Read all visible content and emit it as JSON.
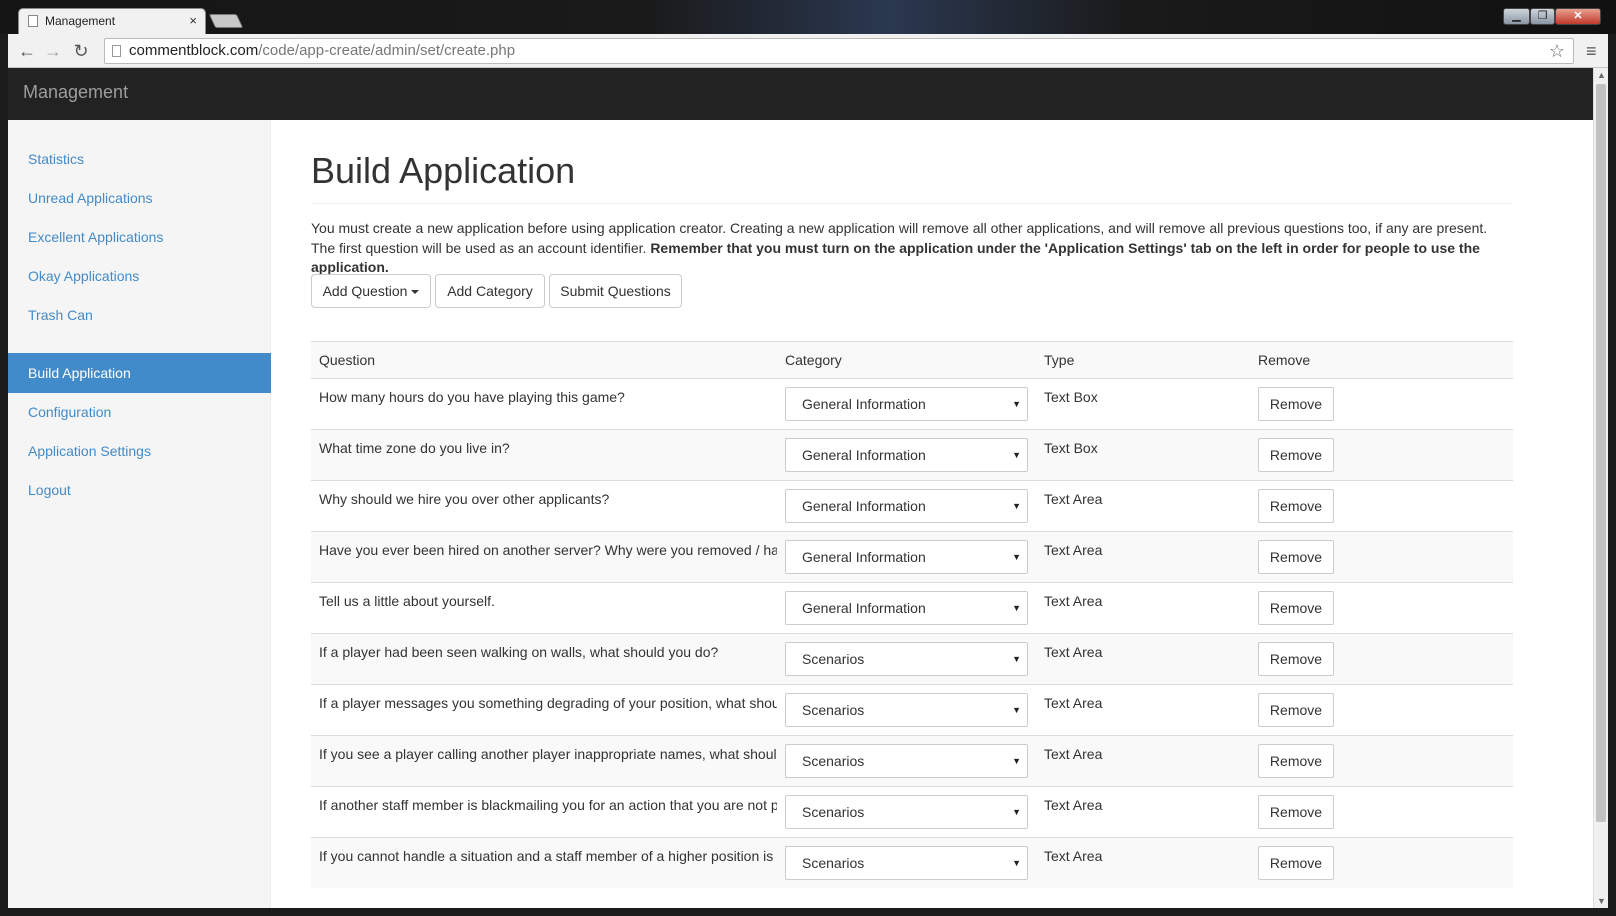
{
  "browser": {
    "tab_title": "Management",
    "tab_close": "×",
    "url_host": "commentblock.com",
    "url_path": "/code/app-create/admin/set/create.php",
    "window_min": "▁",
    "window_max": "❐",
    "window_close": "✕"
  },
  "navbar": {
    "brand": "Management"
  },
  "sidebar": {
    "items": [
      {
        "label": "Statistics"
      },
      {
        "label": "Unread Applications"
      },
      {
        "label": "Excellent Applications"
      },
      {
        "label": "Okay Applications"
      },
      {
        "label": "Trash Can"
      },
      {
        "label": "Build Application"
      },
      {
        "label": "Configuration"
      },
      {
        "label": "Application Settings"
      },
      {
        "label": "Logout"
      }
    ],
    "active_item": "Build Application"
  },
  "main": {
    "title": "Build Application",
    "intro_text": "You must create a new application before using application creator. Creating a new application will remove all other applications, and will remove all previous questions too, if any are present. The first question will be used as an account identifier. ",
    "intro_bold": "Remember that you must turn on the application under the 'Application Settings' tab on the left in order for people to use the application.",
    "buttons": {
      "add_question": "Add Question",
      "add_category": "Add Category",
      "submit_questions": "Submit Questions"
    },
    "table": {
      "headers": [
        "Question",
        "Category",
        "Type",
        "Remove"
      ],
      "rows": [
        {
          "question": "How many hours do you have playing this game?",
          "category": "General Information",
          "type": "Text Box",
          "remove": "Remove"
        },
        {
          "question": "What time zone do you live in?",
          "category": "General Information",
          "type": "Text Box",
          "remove": "Remove"
        },
        {
          "question": "Why should we hire you over other applicants?",
          "category": "General Information",
          "type": "Text Area",
          "remove": "Remove"
        },
        {
          "question": "Have you ever been hired on another server? Why were you removed / ha",
          "category": "General Information",
          "type": "Text Area",
          "remove": "Remove"
        },
        {
          "question": "Tell us a little about yourself.",
          "category": "General Information",
          "type": "Text Area",
          "remove": "Remove"
        },
        {
          "question": "If a player had been seen walking on walls, what should you do?",
          "category": "Scenarios",
          "type": "Text Area",
          "remove": "Remove"
        },
        {
          "question": "If a player messages you something degrading of your position, what shou",
          "category": "Scenarios",
          "type": "Text Area",
          "remove": "Remove"
        },
        {
          "question": "If you see a player calling another player inappropriate names, what shoul",
          "category": "Scenarios",
          "type": "Text Area",
          "remove": "Remove"
        },
        {
          "question": "If another staff member is blackmailing you for an action that you are not p",
          "category": "Scenarios",
          "type": "Text Area",
          "remove": "Remove"
        },
        {
          "question": "If you cannot handle a situation and a staff member of a higher position is",
          "category": "Scenarios",
          "type": "Text Area",
          "remove": "Remove"
        }
      ]
    }
  },
  "colors": {
    "link": "#428bca",
    "navbar": "#222222",
    "sidebar_bg": "#f5f5f5",
    "active_bg": "#428bca"
  }
}
